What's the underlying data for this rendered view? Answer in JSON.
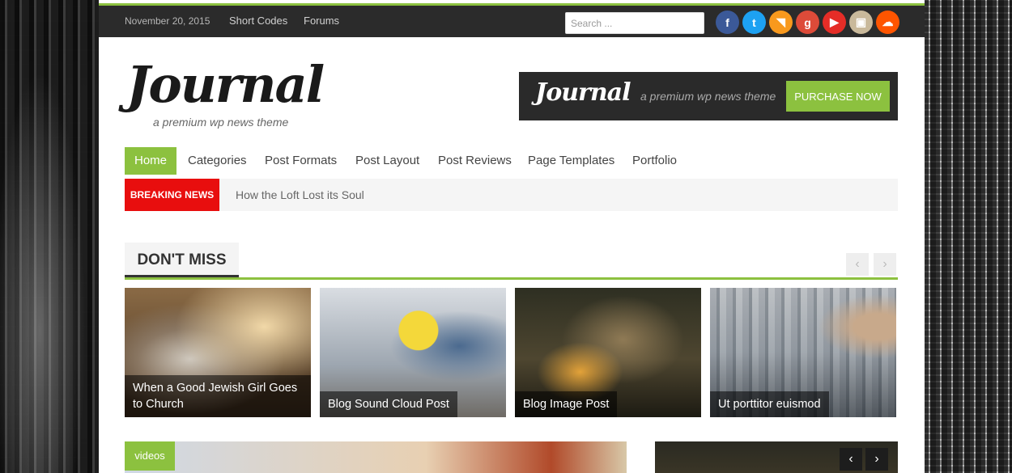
{
  "topbar": {
    "date": "November 20, 2015",
    "links": [
      "Short Codes",
      "Forums"
    ],
    "search_placeholder": "Search ...",
    "social": [
      {
        "icon": "facebook-icon",
        "glyph": "f",
        "color": "#3b5998"
      },
      {
        "icon": "twitter-icon",
        "glyph": "t",
        "color": "#1da1f2"
      },
      {
        "icon": "rss-icon",
        "glyph": "◥",
        "color": "#f8991d"
      },
      {
        "icon": "google-plus-icon",
        "glyph": "g",
        "color": "#dd4b39"
      },
      {
        "icon": "youtube-icon",
        "glyph": "▶",
        "color": "#e52d27"
      },
      {
        "icon": "instagram-icon",
        "glyph": "▣",
        "color": "#c9b99b"
      },
      {
        "icon": "soundcloud-icon",
        "glyph": "☁",
        "color": "#ff5500"
      }
    ],
    "accent_color": "#8cc13f"
  },
  "header": {
    "logo_text": "Journal",
    "tagline": "a premium wp news theme",
    "banner": {
      "logo_text": "Journal",
      "tagline": "a premium wp news theme",
      "button_label": "PURCHASE NOW"
    }
  },
  "nav": {
    "items": [
      "Home",
      "Categories",
      "Post Formats",
      "Post Layout",
      "Post Reviews",
      "Page Templates",
      "Portfolio"
    ],
    "active": "Home"
  },
  "breaking": {
    "label": "BREAKING NEWS",
    "headline": "How the Loft Lost its Soul",
    "label_color": "#e80e0e"
  },
  "dont_miss": {
    "title": "DON'T MISS",
    "prev_icon": "chevron-left-icon",
    "next_icon": "chevron-right-icon",
    "cards": [
      {
        "title": "When a Good Jewish Girl Goes to Church"
      },
      {
        "title": "Blog Sound Cloud Post"
      },
      {
        "title": "Blog Image Post"
      },
      {
        "title": "Ut porttitor euismod"
      }
    ]
  },
  "videos": {
    "label": "videos"
  }
}
